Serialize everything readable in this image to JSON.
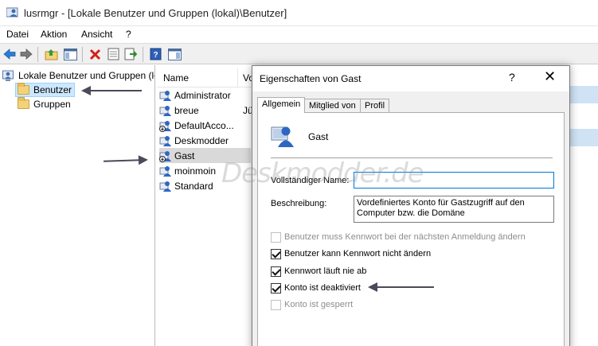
{
  "window": {
    "title": "lusrmgr - [Lokale Benutzer und Gruppen (lokal)\\Benutzer]"
  },
  "menu": [
    "Datei",
    "Aktion",
    "Ansicht",
    "?"
  ],
  "tree": {
    "root": "Lokale Benutzer und Gruppen (lokal)",
    "children": [
      "Benutzer",
      "Gruppen"
    ],
    "selected": "Benutzer"
  },
  "list": {
    "columns": [
      "Name",
      "Vollständiger Name"
    ],
    "rows": [
      {
        "name": "Administrator",
        "full": ""
      },
      {
        "name": "breue",
        "full": "Jü"
      },
      {
        "name": "DefaultAcco...",
        "full": ""
      },
      {
        "name": "Deskmodder",
        "full": ""
      },
      {
        "name": "Gast",
        "full": ""
      },
      {
        "name": "moinmoin",
        "full": ""
      },
      {
        "name": "Standard",
        "full": ""
      }
    ],
    "selected_row": "Gast"
  },
  "dialog": {
    "title": "Eigenschaften von Gast",
    "help": "?",
    "close": "✕",
    "tabs": [
      "Allgemein",
      "Mitglied von",
      "Profil"
    ],
    "active_tab": "Allgemein",
    "user_name": "Gast",
    "fullname_label": "Vollständiger Name:",
    "fullname_value": "",
    "description_label": "Beschreibung:",
    "description_value": "Vordefiniertes Konto für Gastzugriff auf den Computer bzw. die Domäne",
    "checkboxes": [
      {
        "label": "Benutzer muss Kennwort bei der nächsten Anmeldung ändern",
        "checked": false,
        "enabled": false
      },
      {
        "label": "Benutzer kann Kennwort nicht ändern",
        "checked": true,
        "enabled": true
      },
      {
        "label": "Kennwort läuft nie ab",
        "checked": true,
        "enabled": true
      },
      {
        "label": "Konto ist deaktiviert",
        "checked": true,
        "enabled": true
      },
      {
        "label": "Konto ist gesperrt",
        "checked": false,
        "enabled": false
      }
    ]
  },
  "watermark": "Deskmodder.de",
  "colors": {
    "selection": "#cce8ff",
    "row_selected": "#d9d9d9",
    "arrow": "#4a4a5a"
  }
}
